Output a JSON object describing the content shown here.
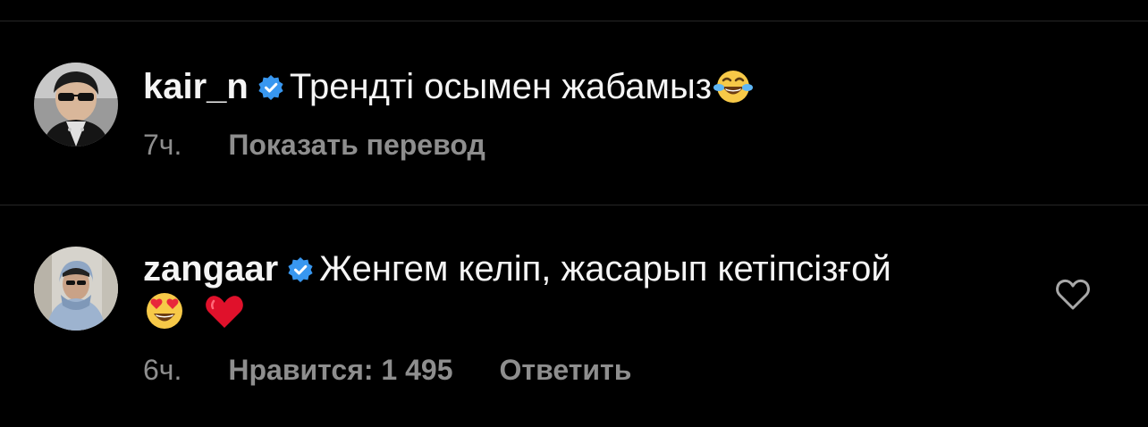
{
  "comments": [
    {
      "username": "kair_n",
      "text": "Трендті осымен жабамыз",
      "emojis": [
        "face-with-tears-of-joy-emoji"
      ],
      "time": "7ч.",
      "actions": [
        "Показать перевод"
      ]
    },
    {
      "username": "zangaar",
      "text": "Женгем келіп, жасарып кетіпсізғой",
      "emojis": [
        "smiling-face-with-heart-eyes-emoji",
        "red-heart-emoji"
      ],
      "time": "6ч.",
      "likes_label": "Нравится: 1 495",
      "reply_label": "Ответить"
    }
  ],
  "colors": {
    "background": "#000000",
    "text": "#f5f5f5",
    "secondary": "#8e8e8e",
    "verified": "#3897f0",
    "divider": "#262626"
  }
}
